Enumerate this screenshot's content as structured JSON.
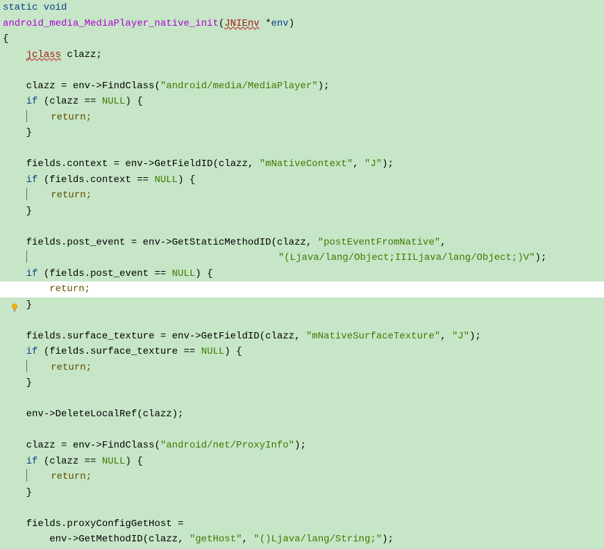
{
  "code": {
    "l1_static_void": "static void",
    "l2_fn": "android_media_MediaPlayer_native_init",
    "l2_open_paren": "(",
    "l2_jnienv": "JNIEnv",
    "l2_star": " *",
    "l2_env": "env",
    "l2_close": ")",
    "l3_brace": "{",
    "l4_indent": "    ",
    "l4_jclass": "jclass",
    "l4_clazz": " clazz;",
    "l6_indent": "    ",
    "l6_lhs": "clazz = env->FindClass(",
    "l6_str": "\"android/media/MediaPlayer\"",
    "l6_end": ");",
    "l7_indent": "    ",
    "l7_if": "if",
    "l7_cond_a": " (clazz == ",
    "l7_null": "NULL",
    "l7_cond_b": ") {",
    "l8_indent": "    ",
    "l8_pad": "    ",
    "l8_return": "return",
    "l8_semi": ";",
    "l9_indent": "    ",
    "l9_brace": "}",
    "l11_indent": "    ",
    "l11_a": "fields.context = env->GetFieldID(clazz",
    "l11_c1": ", ",
    "l11_s1": "\"mNativeContext\"",
    "l11_c2": ", ",
    "l11_s2": "\"J\"",
    "l11_end": ");",
    "l12_indent": "    ",
    "l12_if": "if",
    "l12_a": " (fields.context == ",
    "l12_null": "NULL",
    "l12_b": ") {",
    "l13_indent": "    ",
    "l13_pad": "    ",
    "l13_return": "return",
    "l13_semi": ";",
    "l14_indent": "    ",
    "l14_brace": "}",
    "l16_indent": "    ",
    "l16_a": "fields.post_event = env->GetStaticMethodID(clazz",
    "l16_c1": ", ",
    "l16_s1": "\"postEventFromNative\"",
    "l16_end": ",",
    "l17_indent": "    ",
    "l17_pad": "                                           ",
    "l17_s": "\"(Ljava/lang/Object;IIILjava/lang/Object;)V\"",
    "l17_end": ");",
    "l18_indent": "    ",
    "l18_if": "if",
    "l18_a": " (fields.post_event == ",
    "l18_null": "NULL",
    "l18_b": ") {",
    "l19_indent": "        ",
    "l19_return": "return",
    "l19_semi": ";",
    "l20_indent": "    ",
    "l20_brace": "}",
    "l22_indent": "    ",
    "l22_a": "fields.surface_texture = env->GetFieldID(clazz",
    "l22_c1": ", ",
    "l22_s1": "\"mNativeSurfaceTexture\"",
    "l22_c2": ", ",
    "l22_s2": "\"J\"",
    "l22_end": ");",
    "l23_indent": "    ",
    "l23_if": "if",
    "l23_a": " (fields.surface_texture == ",
    "l23_null": "NULL",
    "l23_b": ") {",
    "l24_indent": "    ",
    "l24_pad": "    ",
    "l24_return": "return",
    "l24_semi": ";",
    "l25_indent": "    ",
    "l25_brace": "}",
    "l27_indent": "    ",
    "l27_a": "env->DeleteLocalRef(clazz);",
    "l29_indent": "    ",
    "l29_a": "clazz = env->FindClass(",
    "l29_s": "\"android/net/ProxyInfo\"",
    "l29_end": ");",
    "l30_indent": "    ",
    "l30_if": "if",
    "l30_a": " (clazz == ",
    "l30_null": "NULL",
    "l30_b": ") {",
    "l31_indent": "    ",
    "l31_pad": "    ",
    "l31_return": "return",
    "l31_semi": ";",
    "l32_indent": "    ",
    "l32_brace": "}",
    "l34_indent": "    ",
    "l34_a": "fields.proxyConfigGetHost =",
    "l35_indent": "        ",
    "l35_a": "env->GetMethodID(clazz",
    "l35_c1": ", ",
    "l35_s1": "\"getHost\"",
    "l35_c2": ", ",
    "l35_s2": "\"()Ljava/lang/String;\"",
    "l35_end": ");"
  },
  "icons": {
    "intention_bulb": "lightbulb-icon"
  }
}
